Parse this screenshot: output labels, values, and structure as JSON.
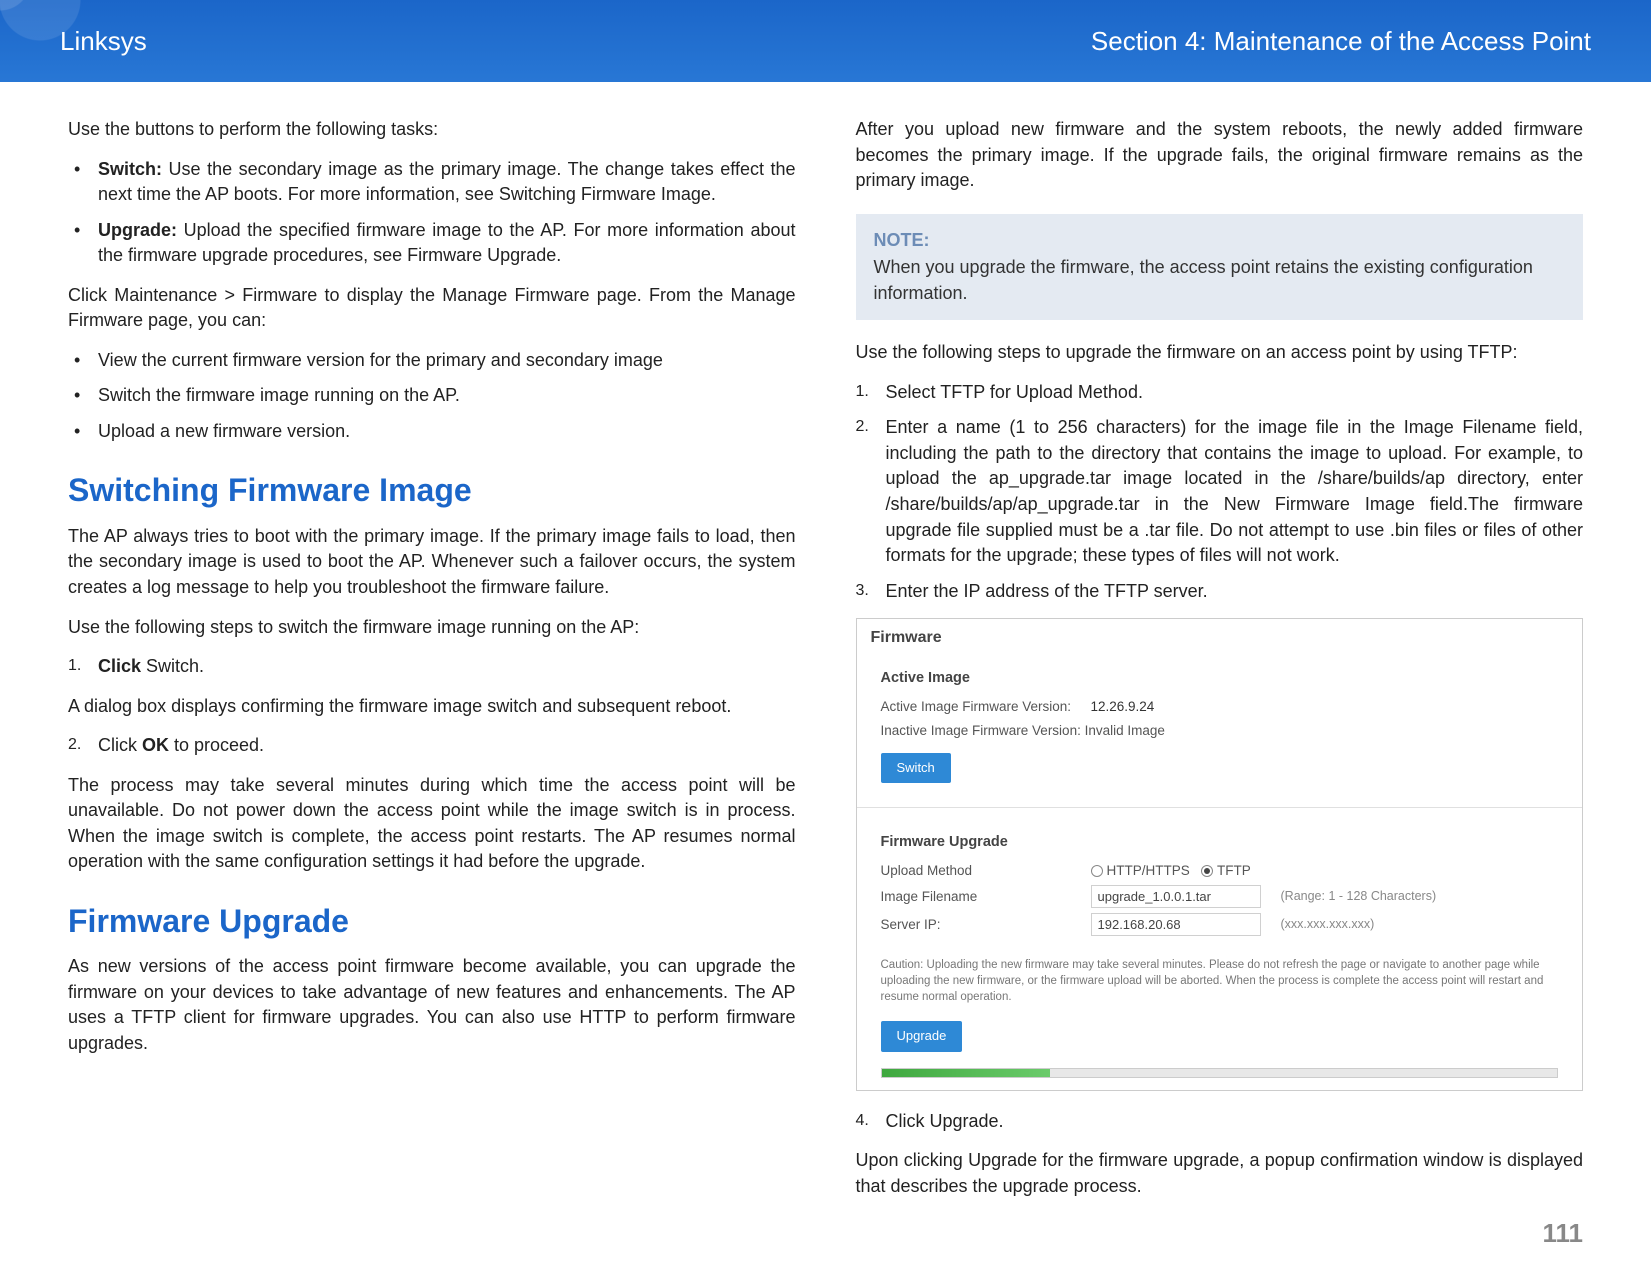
{
  "header": {
    "brand": "Linksys",
    "section": "Section 4: Maintenance of the Access Point"
  },
  "left": {
    "intro": "Use the buttons to perform the following tasks:",
    "bullets1": [
      {
        "label": "Switch:",
        "text": " Use the secondary image as the primary image. The change takes effect the next time the AP boots. For more information, see Switching Firmware Image."
      },
      {
        "label": "Upgrade:",
        "text": " Upload the specified firmware image to the AP. For more information about the firmware upgrade procedures, see Firmware Upgrade."
      }
    ],
    "p_click": "Click Maintenance > Firmware to display the Manage Firmware page. From the Manage Firmware page, you can:",
    "bullets2": [
      "View the current firmware version for the primary and secondary image",
      "Switch the firmware image running on the AP.",
      "Upload a new firmware version."
    ],
    "h_switch": "Switching Firmware Image",
    "switch_p1": "The AP always tries to boot with the primary image. If the primary image fails to load, then the secondary image is used to boot the AP. Whenever such a failover occurs, the system creates a log message to help you troubleshoot the firmware failure.",
    "switch_p2": "Use the following steps to switch the firmware image running on the AP:",
    "switch_step1_num": "1.",
    "switch_step1_b": "Click",
    "switch_step1_rest": " Switch.",
    "switch_p3": "A dialog box displays confirming the firmware image switch and subsequent reboot.",
    "switch_step2_num": "2.",
    "switch_step2_pre": "Click ",
    "switch_step2_b": "OK",
    "switch_step2_post": " to proceed.",
    "switch_p4": "The process may take several minutes during which time the access point will be unavailable. Do not power down the access point while the image switch is in process. When the image switch is complete, the access point restarts. The AP resumes normal operation with the same configuration settings it had before the upgrade.",
    "h_upgrade": "Firmware Upgrade",
    "upgrade_p1": "As new versions of the access point firmware become available, you can upgrade the firmware on your devices to take advantage of new features and enhancements. The AP uses a TFTP client for firmware upgrades. You can also use HTTP to perform firmware upgrades."
  },
  "right": {
    "p_after": "After you upload new firmware and the system reboots, the newly added firmware becomes the primary image. If the upgrade fails, the original firmware remains as the primary image.",
    "note_title": "NOTE:",
    "note_text": "When you upgrade the firmware, the access point retains the existing configuration information.",
    "p_steps": "Use the following steps to upgrade the firmware on an access point by using TFTP:",
    "steps": [
      {
        "num": "1.",
        "text": "Select TFTP for Upload Method."
      },
      {
        "num": "2.",
        "text": "Enter a name (1 to 256 characters) for the image file in the Image Filename field, including the path to the directory that contains the image to upload. For example, to upload the ap_upgrade.tar image located in the /share/builds/ap directory, enter /share/builds/ap/ap_upgrade.tar in the New Firmware Image field.The firmware upgrade file supplied must be a .tar file. Do not attempt to use .bin files or files of other formats for the upgrade; these types of files will not work."
      },
      {
        "num": "3.",
        "text": "Enter the IP address of the TFTP server."
      }
    ],
    "screenshot": {
      "title": "Firmware",
      "active_label": "Active Image",
      "row_active_ver_lbl": "Active Image Firmware Version:",
      "row_active_ver_val": "12.26.9.24",
      "row_inactive": "Inactive Image Firmware Version: Invalid Image",
      "btn_switch": "Switch",
      "fu_label": "Firmware Upgrade",
      "upload_method_lbl": "Upload Method",
      "http_label": "HTTP/HTTPS",
      "tftp_label": "TFTP",
      "image_filename_lbl": "Image Filename",
      "image_filename_val": "upgrade_1.0.0.1.tar",
      "range_hint": "(Range: 1 - 128 Characters)",
      "server_ip_lbl": "Server IP:",
      "server_ip_val": "192.168.20.68",
      "ip_hint": "(xxx.xxx.xxx.xxx)",
      "caution": "Caution: Uploading the new firmware may take several minutes. Please do not refresh the page or navigate to another page while uploading the new firmware, or the firmware upload will be aborted. When the process is complete the access point will restart and resume normal operation.",
      "btn_upgrade": "Upgrade"
    },
    "step4_num": "4.",
    "step4_text": "Click Upgrade.",
    "p_upon": "Upon clicking Upgrade for the firmware upgrade, a popup confirmation window is displayed that describes the upgrade process."
  },
  "page_number": "111"
}
